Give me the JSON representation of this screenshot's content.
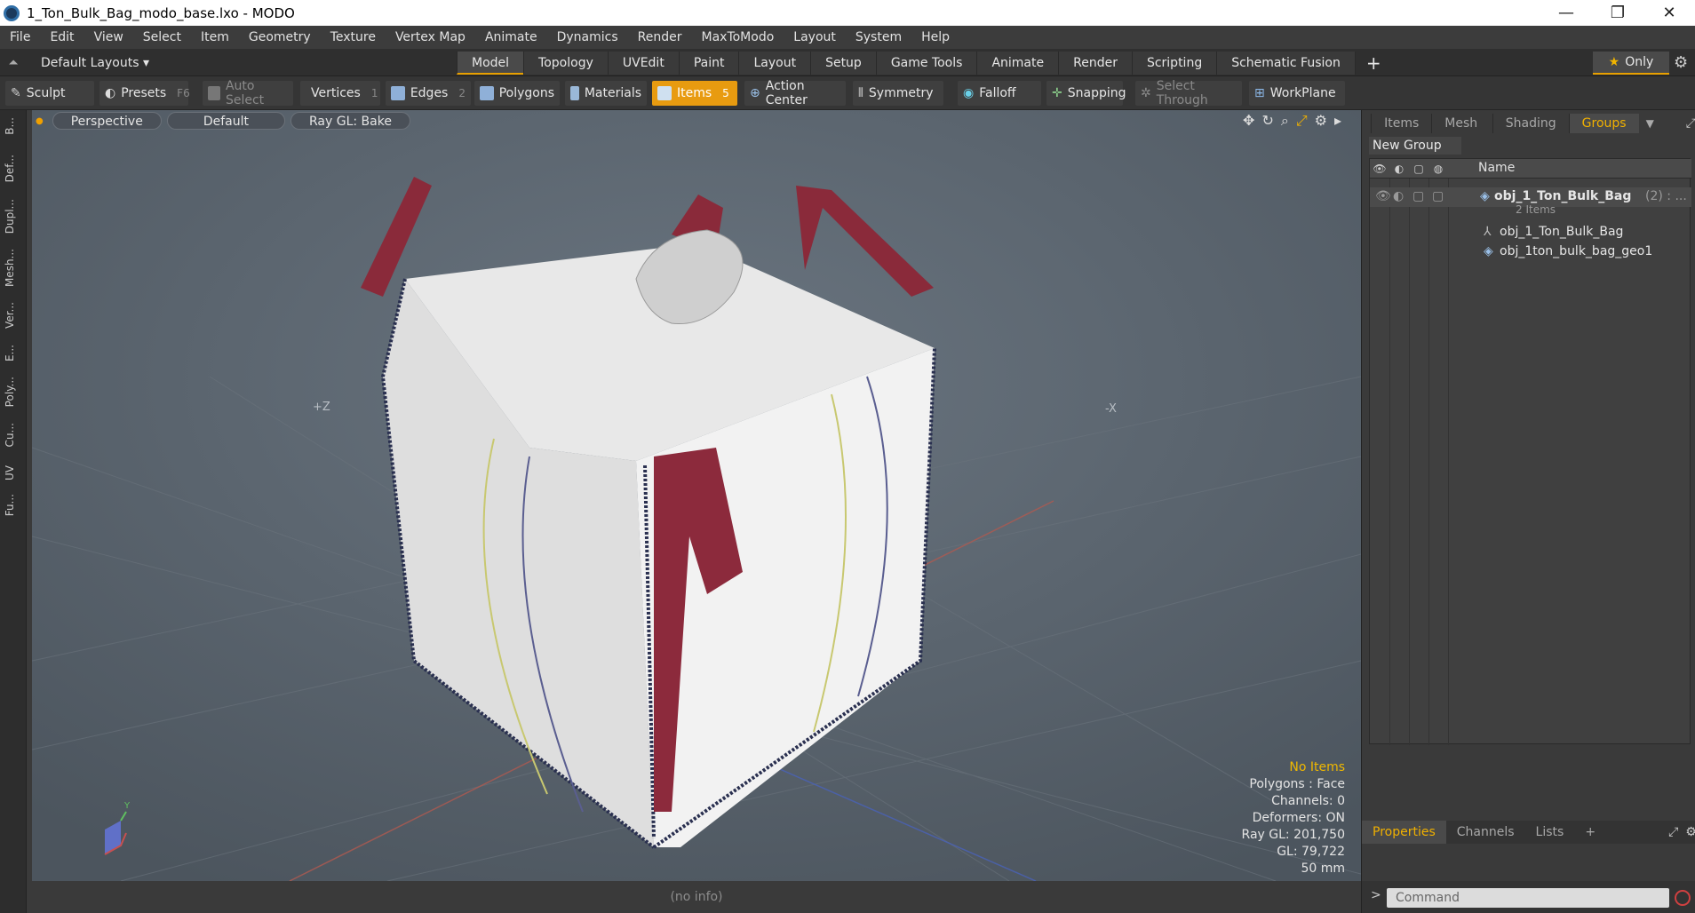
{
  "window": {
    "title": "1_Ton_Bulk_Bag_modo_base.lxo - MODO",
    "minimize": "—",
    "maximize": "❐",
    "close": "✕"
  },
  "menu": [
    "File",
    "Edit",
    "View",
    "Select",
    "Item",
    "Geometry",
    "Texture",
    "Vertex Map",
    "Animate",
    "Dynamics",
    "Render",
    "MaxToModo",
    "Layout",
    "System",
    "Help"
  ],
  "layouts": {
    "label": "Default Layouts ▾",
    "tabs": [
      "Model",
      "Topology",
      "UVEdit",
      "Paint",
      "Layout",
      "Setup",
      "Game Tools",
      "Animate",
      "Render",
      "Scripting",
      "Schematic Fusion"
    ],
    "active_tab": "Model",
    "plus": "+",
    "only": "Only"
  },
  "toolbar": {
    "sculpt": "Sculpt",
    "presets": "Presets",
    "presets_key": "F6",
    "auto_select": "Auto Select",
    "vertices": "Vertices",
    "vertices_count": "1",
    "edges": "Edges",
    "edges_count": "2",
    "polygons": "Polygons",
    "materials": "Materials",
    "items": "Items",
    "items_count": "5",
    "action_center": "Action Center",
    "symmetry": "Symmetry",
    "falloff": "Falloff",
    "snapping": "Snapping",
    "select_through": "Select Through",
    "workplane": "WorkPlane"
  },
  "left_strip": [
    "B...",
    "Def...",
    "Dupl...",
    "Mesh...",
    "Ver...",
    "E...",
    "Poly...",
    "Cu...",
    "UV",
    "Fu..."
  ],
  "viewport": {
    "view": "Perspective",
    "shading": "Default",
    "render": "Ray GL: Bake",
    "axis_z": "+Z",
    "axis_x": "-X",
    "info": {
      "selection": "No Items",
      "polygons": "Polygons : Face",
      "channels": "Channels: 0",
      "deformers": "Deformers: ON",
      "raygl": "Ray GL: 201,750",
      "gl": "GL: 79,722",
      "unit": "50 mm"
    }
  },
  "status": "(no info)",
  "groups_panel": {
    "tabs": [
      "Items",
      "Mesh ...",
      "Shading",
      "Groups"
    ],
    "active": "Groups",
    "new_group": "New Group",
    "name_col": "Name",
    "rows": [
      {
        "name": "obj_1_Ton_Bulk_Bag",
        "suffix": "(2) : ..."
      },
      {
        "name": "2 Items"
      },
      {
        "name": "obj_1_Ton_Bulk_Bag"
      },
      {
        "name": "obj_1ton_bulk_bag_geo1"
      }
    ]
  },
  "bottom_panel": {
    "tabs": [
      "Properties",
      "Channels",
      "Lists",
      "+"
    ],
    "active": "Properties",
    "command_placeholder": "Command",
    "prompt": ">"
  }
}
